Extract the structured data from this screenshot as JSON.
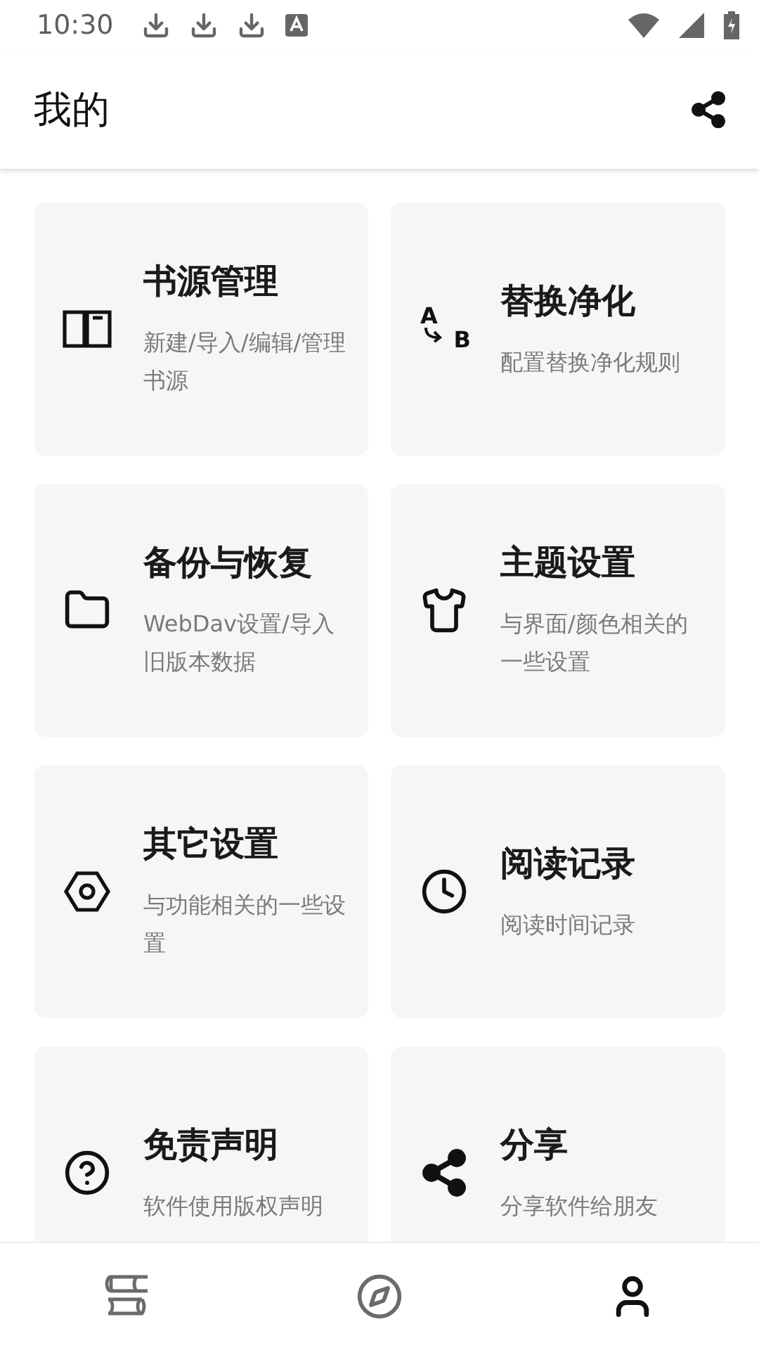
{
  "status_bar": {
    "time": "10:30"
  },
  "app_bar": {
    "title": "我的"
  },
  "cards": [
    {
      "title": "书源管理",
      "description": "新建/导入/编辑/管理书源"
    },
    {
      "icon_letters": [
        "A",
        "B"
      ],
      "title": "替换净化",
      "description": "配置替换净化规则"
    },
    {
      "title": "备份与恢复",
      "description": "WebDav设置/导入旧版本数据"
    },
    {
      "title": "主题设置",
      "description": "与界面/颜色相关的一些设置"
    },
    {
      "title": "其它设置",
      "description": "与功能相关的一些设置"
    },
    {
      "title": "阅读记录",
      "description": "阅读时间记录"
    },
    {
      "title": "免责声明",
      "description": "软件使用版权声明"
    },
    {
      "title": "分享",
      "description": "分享软件给朋友"
    }
  ],
  "bottom_nav": [
    {
      "selected": false
    },
    {
      "selected": false
    },
    {
      "selected": true
    }
  ]
}
